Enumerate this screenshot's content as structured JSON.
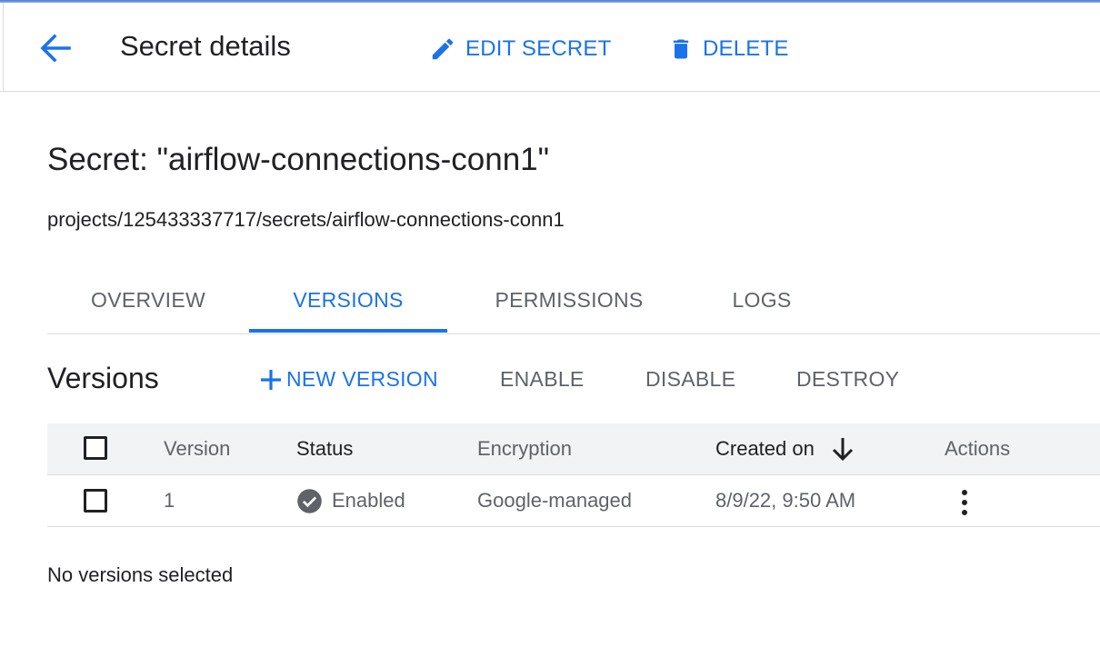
{
  "header": {
    "title": "Secret details",
    "edit_label": "EDIT SECRET",
    "delete_label": "DELETE"
  },
  "secret": {
    "title": "Secret: \"airflow-connections-conn1\"",
    "path": "projects/125433337717/secrets/airflow-connections-conn1"
  },
  "tabs": [
    {
      "label": "OVERVIEW",
      "active": false
    },
    {
      "label": "VERSIONS",
      "active": true
    },
    {
      "label": "PERMISSIONS",
      "active": false
    },
    {
      "label": "LOGS",
      "active": false
    }
  ],
  "versions": {
    "heading": "Versions",
    "toolbar": {
      "new_version": "NEW VERSION",
      "enable": "ENABLE",
      "disable": "DISABLE",
      "destroy": "DESTROY"
    },
    "columns": {
      "version": "Version",
      "status": "Status",
      "encryption": "Encryption",
      "created_on": "Created on",
      "actions": "Actions"
    },
    "sort": {
      "column": "created_on",
      "direction": "descending"
    },
    "rows": [
      {
        "version": "1",
        "status": "Enabled",
        "encryption": "Google-managed",
        "created_on": "8/9/22, 9:50 AM"
      }
    ],
    "selection_status": "No versions selected"
  },
  "colors": {
    "accent": "#1a73e8",
    "text_primary": "#202124",
    "text_secondary": "#5f6368",
    "divider": "#dadce0",
    "table_header_bg": "#f1f3f4",
    "status_enabled_icon": "#5f6368"
  },
  "icons": {
    "back": "arrow-back-icon",
    "edit": "pencil-icon",
    "delete": "trash-icon",
    "add": "plus-icon",
    "sort": "arrow-down-icon",
    "status": "check-circle-icon",
    "more": "more-vert-icon"
  }
}
